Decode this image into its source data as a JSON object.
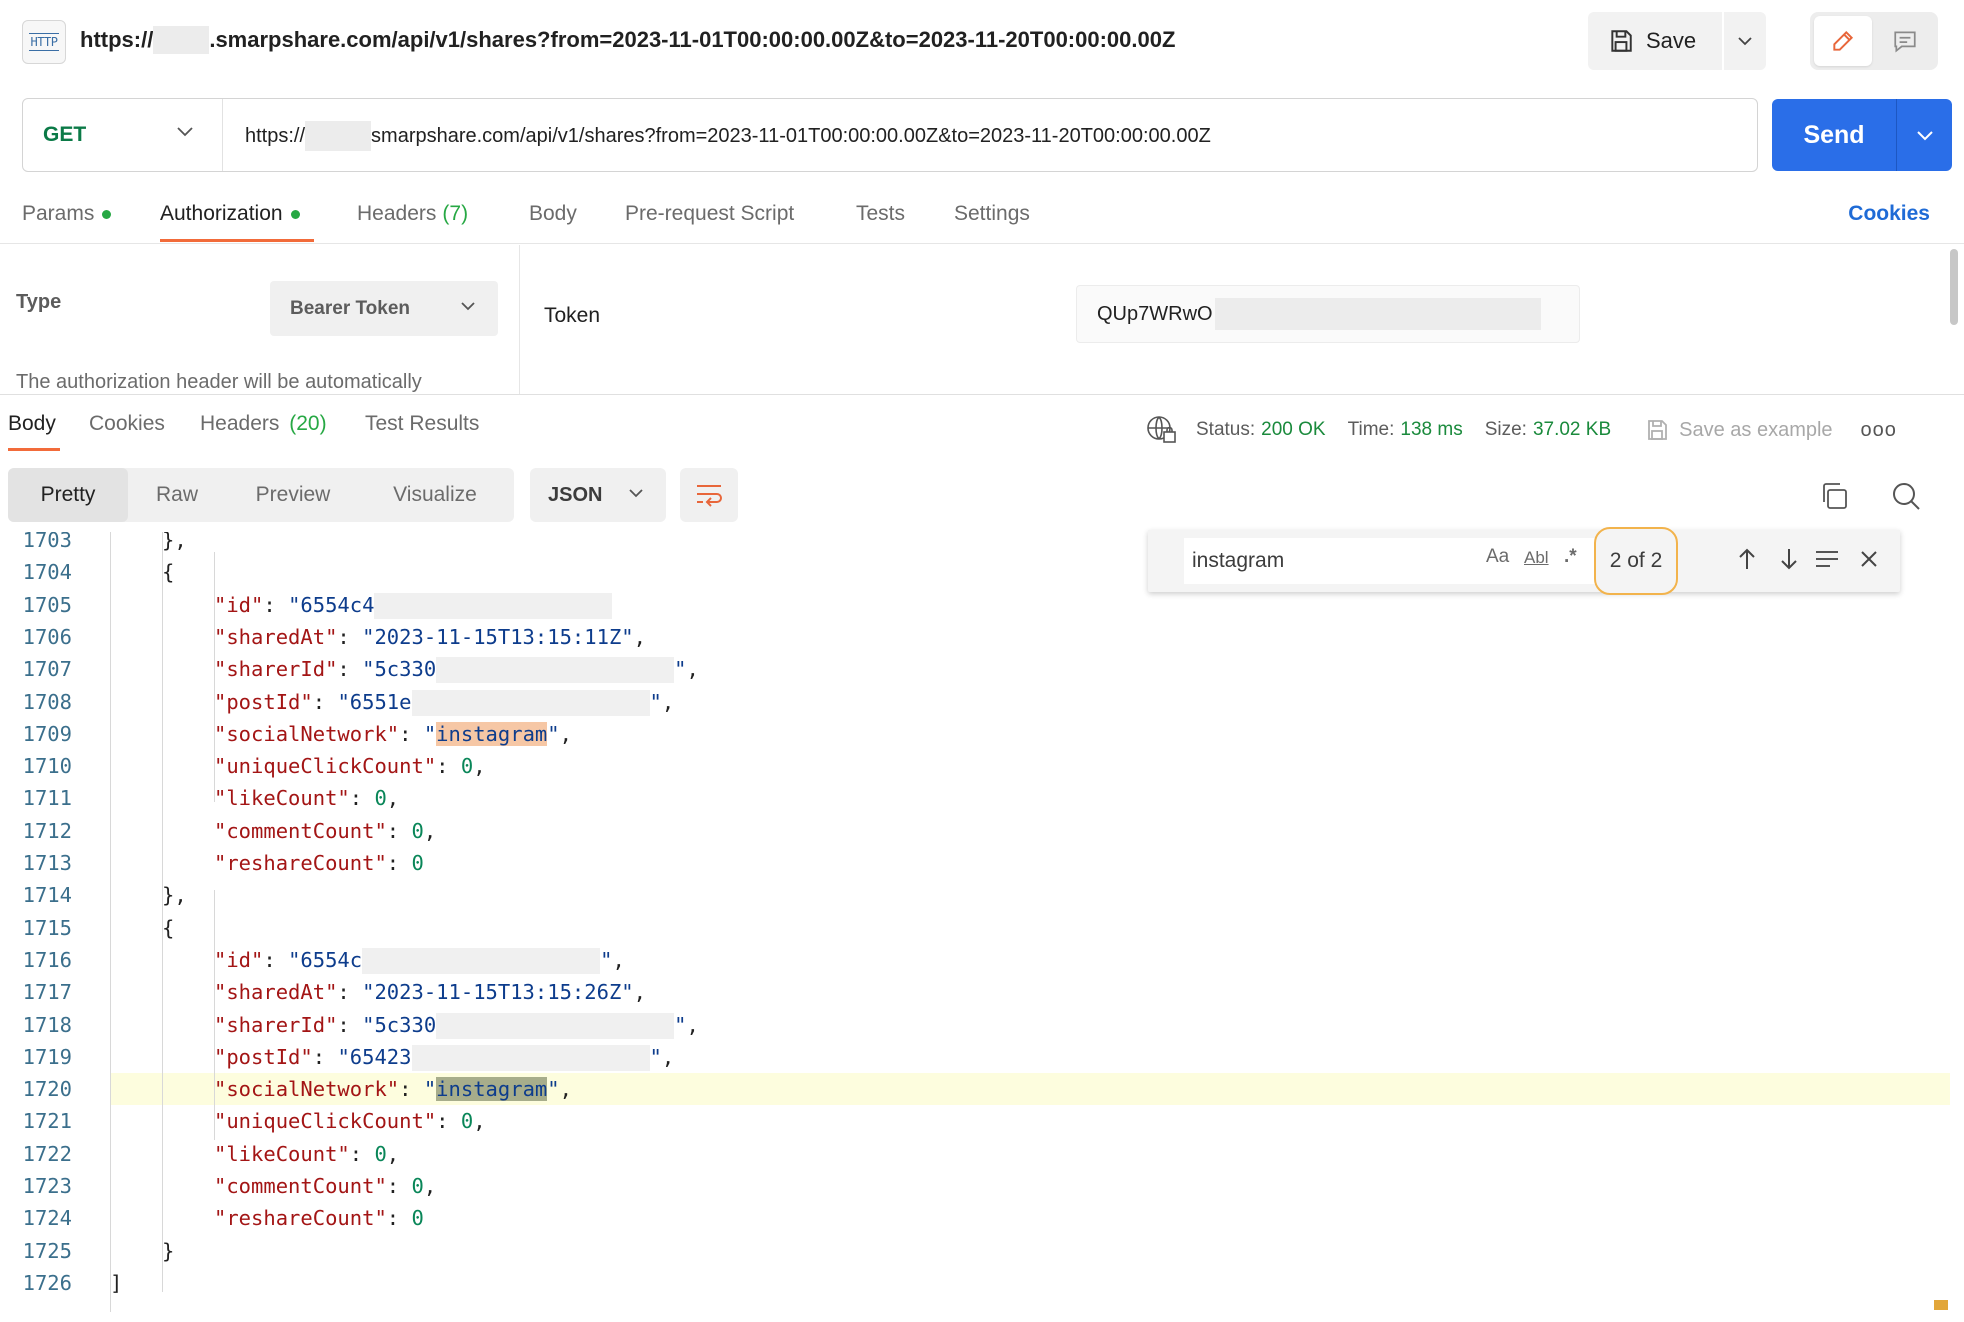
{
  "titlebar": {
    "badge": "HTTP",
    "title_prefix": "https://",
    "title_suffix": ".smarpshare.com/api/v1/shares?from=2023-11-01T00:00:00.00Z&to=2023-11-20T00:00:00.00Z",
    "save_label": "Save"
  },
  "request": {
    "method": "GET",
    "url_prefix": "https://",
    "url_suffix": "smarpshare.com/api/v1/shares?from=2023-11-01T00:00:00.00Z&to=2023-11-20T00:00:00.00Z",
    "send_label": "Send"
  },
  "request_tabs": {
    "params": "Params",
    "authorization": "Authorization",
    "headers": "Headers",
    "headers_count": "(7)",
    "body": "Body",
    "pre_request": "Pre-request Script",
    "tests": "Tests",
    "settings": "Settings",
    "cookies": "Cookies"
  },
  "auth": {
    "type_label": "Type",
    "type_value": "Bearer Token",
    "description": "The authorization header will be automatically",
    "token_label": "Token",
    "token_value": "QUp7WRwO"
  },
  "response_tabs": {
    "body": "Body",
    "cookies": "Cookies",
    "headers": "Headers",
    "headers_count": "(20)",
    "test_results": "Test Results"
  },
  "response_meta": {
    "status_label": "Status:",
    "status_value": "200 OK",
    "time_label": "Time:",
    "time_value": "138 ms",
    "size_label": "Size:",
    "size_value": "37.02 KB",
    "save_example": "Save as example",
    "more": "ooo"
  },
  "view": {
    "pretty": "Pretty",
    "raw": "Raw",
    "preview": "Preview",
    "visualize": "Visualize",
    "format": "JSON"
  },
  "find": {
    "query": "instagram",
    "match_case": "Aa",
    "whole_word": "Abl",
    "regex": ".*",
    "match_count": "2 of 2"
  },
  "code_lines": [
    {
      "n": "1703",
      "indent": 1,
      "parts": [
        [
          "p",
          "},"
        ]
      ]
    },
    {
      "n": "1704",
      "indent": 1,
      "parts": [
        [
          "p",
          "{"
        ]
      ]
    },
    {
      "n": "1705",
      "indent": 2,
      "parts": [
        [
          "k",
          "\"id\""
        ],
        [
          "p",
          ": "
        ],
        [
          "s",
          "\"6554c4"
        ],
        [
          "r",
          ""
        ]
      ]
    },
    {
      "n": "1706",
      "indent": 2,
      "parts": [
        [
          "k",
          "\"sharedAt\""
        ],
        [
          "p",
          ": "
        ],
        [
          "s",
          "\"2023-11-15T13:15:11Z\""
        ],
        [
          "p",
          ","
        ]
      ]
    },
    {
      "n": "1707",
      "indent": 2,
      "parts": [
        [
          "k",
          "\"sharerId\""
        ],
        [
          "p",
          ": "
        ],
        [
          "s",
          "\"5c330"
        ],
        [
          "r",
          ""
        ],
        [
          "s",
          "\""
        ],
        [
          "p",
          ","
        ]
      ]
    },
    {
      "n": "1708",
      "indent": 2,
      "parts": [
        [
          "k",
          "\"postId\""
        ],
        [
          "p",
          ": "
        ],
        [
          "s",
          "\"6551e"
        ],
        [
          "r",
          ""
        ],
        [
          "s",
          "\""
        ],
        [
          "p",
          ","
        ]
      ]
    },
    {
      "n": "1709",
      "indent": 2,
      "parts": [
        [
          "k",
          "\"socialNetwork\""
        ],
        [
          "p",
          ": "
        ],
        [
          "s",
          "\""
        ],
        [
          "h",
          "instagram"
        ],
        [
          "s",
          "\""
        ],
        [
          "p",
          ","
        ]
      ]
    },
    {
      "n": "1710",
      "indent": 2,
      "parts": [
        [
          "k",
          "\"uniqueClickCount\""
        ],
        [
          "p",
          ": "
        ],
        [
          "d",
          "0"
        ],
        [
          "p",
          ","
        ]
      ]
    },
    {
      "n": "1711",
      "indent": 2,
      "parts": [
        [
          "k",
          "\"likeCount\""
        ],
        [
          "p",
          ": "
        ],
        [
          "d",
          "0"
        ],
        [
          "p",
          ","
        ]
      ]
    },
    {
      "n": "1712",
      "indent": 2,
      "parts": [
        [
          "k",
          "\"commentCount\""
        ],
        [
          "p",
          ": "
        ],
        [
          "d",
          "0"
        ],
        [
          "p",
          ","
        ]
      ]
    },
    {
      "n": "1713",
      "indent": 2,
      "parts": [
        [
          "k",
          "\"reshareCount\""
        ],
        [
          "p",
          ": "
        ],
        [
          "d",
          "0"
        ]
      ]
    },
    {
      "n": "1714",
      "indent": 1,
      "parts": [
        [
          "p",
          "},"
        ]
      ]
    },
    {
      "n": "1715",
      "indent": 1,
      "parts": [
        [
          "p",
          "{"
        ]
      ]
    },
    {
      "n": "1716",
      "indent": 2,
      "parts": [
        [
          "k",
          "\"id\""
        ],
        [
          "p",
          ": "
        ],
        [
          "s",
          "\"6554c"
        ],
        [
          "r",
          ""
        ],
        [
          "s",
          "\""
        ],
        [
          "p",
          ","
        ]
      ]
    },
    {
      "n": "1717",
      "indent": 2,
      "parts": [
        [
          "k",
          "\"sharedAt\""
        ],
        [
          "p",
          ": "
        ],
        [
          "s",
          "\"2023-11-15T13:15:26Z\""
        ],
        [
          "p",
          ","
        ]
      ]
    },
    {
      "n": "1718",
      "indent": 2,
      "parts": [
        [
          "k",
          "\"sharerId\""
        ],
        [
          "p",
          ": "
        ],
        [
          "s",
          "\"5c330"
        ],
        [
          "r",
          ""
        ],
        [
          "s",
          "\""
        ],
        [
          "p",
          ","
        ]
      ]
    },
    {
      "n": "1719",
      "indent": 2,
      "parts": [
        [
          "k",
          "\"postId\""
        ],
        [
          "p",
          ": "
        ],
        [
          "s",
          "\"65423"
        ],
        [
          "r",
          ""
        ],
        [
          "s",
          "\""
        ],
        [
          "p",
          ","
        ]
      ]
    },
    {
      "n": "1720",
      "indent": 2,
      "current": true,
      "parts": [
        [
          "k",
          "\"socialNetwork\""
        ],
        [
          "p",
          ": "
        ],
        [
          "s",
          "\""
        ],
        [
          "c",
          "instagram"
        ],
        [
          "s",
          "\""
        ],
        [
          "p",
          ","
        ]
      ]
    },
    {
      "n": "1721",
      "indent": 2,
      "parts": [
        [
          "k",
          "\"uniqueClickCount\""
        ],
        [
          "p",
          ": "
        ],
        [
          "d",
          "0"
        ],
        [
          "p",
          ","
        ]
      ]
    },
    {
      "n": "1722",
      "indent": 2,
      "parts": [
        [
          "k",
          "\"likeCount\""
        ],
        [
          "p",
          ": "
        ],
        [
          "d",
          "0"
        ],
        [
          "p",
          ","
        ]
      ]
    },
    {
      "n": "1723",
      "indent": 2,
      "parts": [
        [
          "k",
          "\"commentCount\""
        ],
        [
          "p",
          ": "
        ],
        [
          "d",
          "0"
        ],
        [
          "p",
          ","
        ]
      ]
    },
    {
      "n": "1724",
      "indent": 2,
      "parts": [
        [
          "k",
          "\"reshareCount\""
        ],
        [
          "p",
          ": "
        ],
        [
          "d",
          "0"
        ]
      ]
    },
    {
      "n": "1725",
      "indent": 1,
      "parts": [
        [
          "p",
          "}"
        ]
      ]
    },
    {
      "n": "1726",
      "indent": 0,
      "parts": [
        [
          "p",
          "]"
        ]
      ]
    }
  ],
  "colors": {
    "accent": "#2a6ee8",
    "method": "#0b7a47",
    "tab_underline": "#f26b3a",
    "status_ok": "#1a8a3c",
    "match_highlight": "#f6c7a5",
    "current_match": "#a7ad8b",
    "current_line": "#fdfdde"
  }
}
